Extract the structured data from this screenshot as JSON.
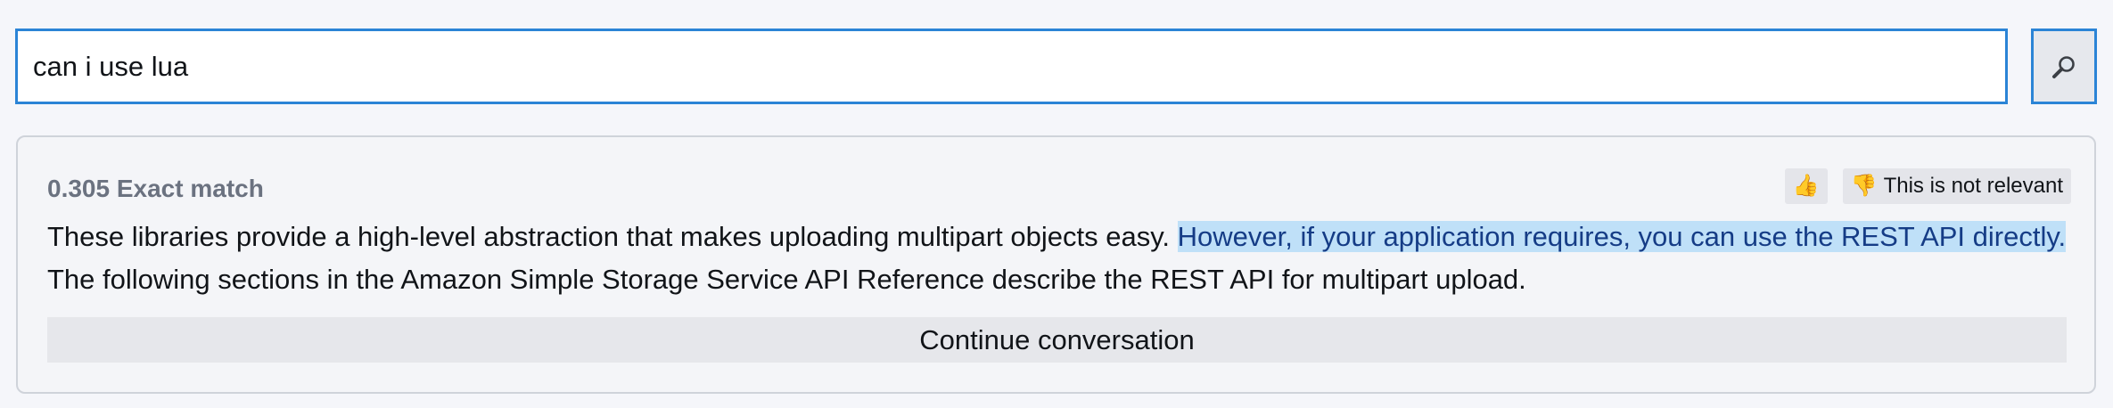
{
  "search": {
    "value": "can i use lua",
    "button_icon": "magnifier-icon"
  },
  "result": {
    "score": "0.305",
    "match_type": "Exact match",
    "feedback": {
      "thumbs_up_icon": "👍",
      "thumbs_down_icon": "👎",
      "not_relevant_label": "This is not relevant"
    },
    "passage": {
      "before": "These libraries provide a high-level abstraction that makes uploading multipart objects easy. ",
      "highlight": "However, if your application requires, you can use the REST API directly.",
      "after": " The following sections in the Amazon Simple Storage Service API Reference describe the REST API for multipart upload."
    },
    "continue_label": "Continue conversation"
  },
  "colors": {
    "accent_border": "#2b84d6",
    "highlight_bg": "#bfe0f8",
    "highlight_text": "#153c86",
    "score_text": "#6b7280"
  }
}
